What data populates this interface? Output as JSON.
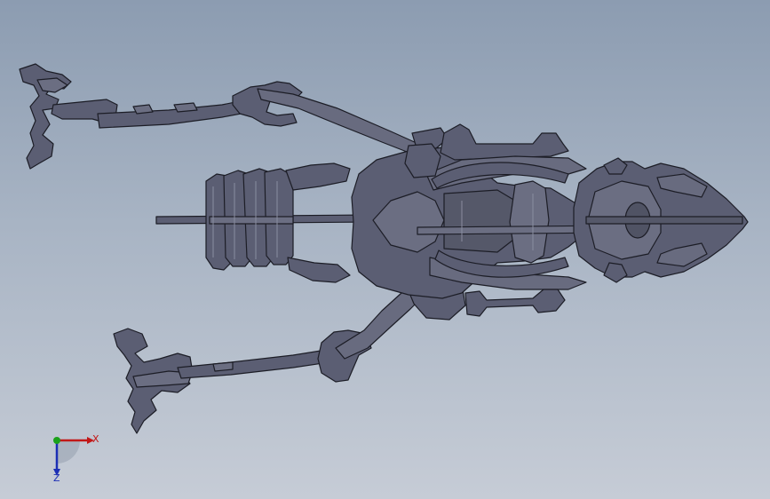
{
  "viewport": {
    "background_top": "#8c9cb1",
    "background_bottom": "#c6ccd6",
    "part_fill": "#5b5e73",
    "part_edge": "#1c1d26",
    "part_highlight": "#7a7d90"
  },
  "triad": {
    "x_label": "X",
    "z_label": "Z",
    "x_color": "#c21818",
    "y_color": "#1aa11a",
    "z_color": "#1c2fb5"
  }
}
